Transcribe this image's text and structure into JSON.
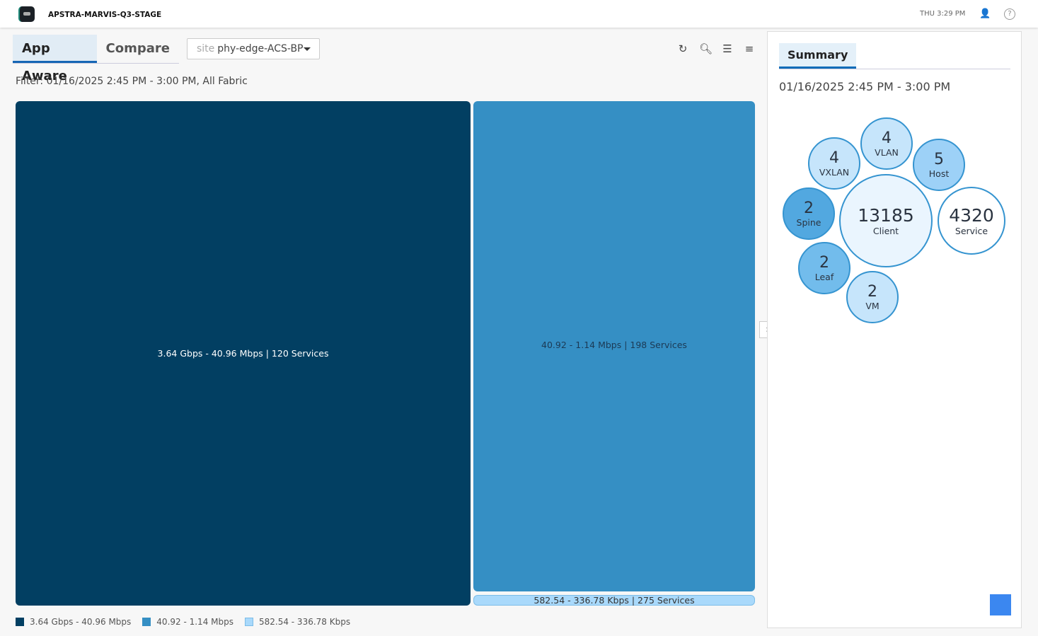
{
  "header": {
    "app_title": "APSTRA-MARVIS-Q3-STAGE",
    "time": "THU 3:29 PM",
    "icons": [
      "user-icon",
      "help-icon"
    ]
  },
  "tabs": [
    {
      "label": "App Aware",
      "active": true
    },
    {
      "label": "Compare",
      "active": false
    }
  ],
  "site_select": {
    "label": "site",
    "value": "phy-edge-ACS-BP"
  },
  "toolbar_icons": [
    "refresh-icon",
    "search-icon",
    "list-icon",
    "filter-icon"
  ],
  "filter_text": "Filter: 01/16/2025 2:45 PM - 3:00 PM, All Fabric",
  "treemap": [
    {
      "label": "3.64 Gbps - 40.96 Mbps | 120 Services",
      "range": "3.64 Gbps - 40.96 Mbps",
      "services": 120,
      "color": "#023f62"
    },
    {
      "label": "40.92 - 1.14 Mbps | 198 Services",
      "range": "40.92 - 1.14 Mbps",
      "services": 198,
      "color": "#358fc4"
    },
    {
      "label": "582.54 - 336.78 Kbps | 275 Services",
      "range": "582.54 - 336.78 Kbps",
      "services": 275,
      "color": "#a9d9fb"
    }
  ],
  "summary": {
    "tab": "Summary",
    "date": "01/16/2025 2:45 PM - 3:00 PM",
    "bubbles": [
      {
        "count": "4",
        "label": "VLAN",
        "color": "#c6e5fb"
      },
      {
        "count": "4",
        "label": "VXLAN",
        "color": "#c6e5fb"
      },
      {
        "count": "5",
        "label": "Host",
        "color": "#9dd1f7"
      },
      {
        "count": "2",
        "label": "Spine",
        "color": "#52a8e0"
      },
      {
        "count": "13185",
        "label": "Client",
        "color": "#eaf5fe"
      },
      {
        "count": "4320",
        "label": "Service",
        "color": "#ffffff"
      },
      {
        "count": "2",
        "label": "Leaf",
        "color": "#72bcec"
      },
      {
        "count": "2",
        "label": "VM",
        "color": "#c6e5fb"
      }
    ]
  }
}
